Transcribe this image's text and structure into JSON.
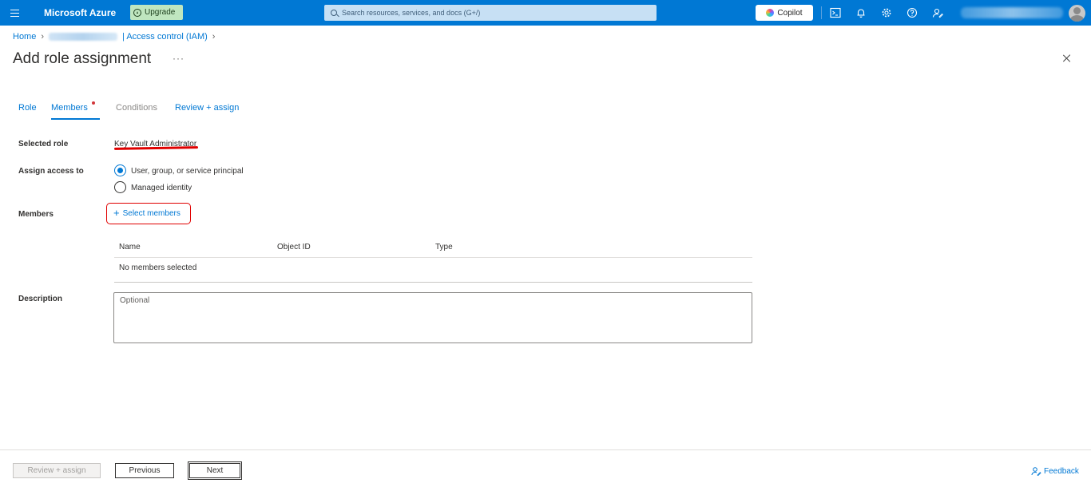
{
  "topbar": {
    "brand": "Microsoft Azure",
    "upgrade_label": "Upgrade",
    "search_placeholder": "Search resources, services, and docs (G+/)",
    "copilot_label": "Copilot",
    "icons": [
      "cloud-shell-icon",
      "bell-icon",
      "gear-icon",
      "help-icon",
      "feedback-person-icon"
    ]
  },
  "breadcrumb": {
    "home": "Home",
    "current": "| Access control (IAM)"
  },
  "page": {
    "title": "Add role assignment",
    "more": "···"
  },
  "tabs": [
    {
      "label": "Role",
      "state": "link"
    },
    {
      "label": "Members",
      "state": "active"
    },
    {
      "label": "Conditions",
      "state": "disabled"
    },
    {
      "label": "Review + assign",
      "state": "link"
    }
  ],
  "form": {
    "selected_role_label": "Selected role",
    "selected_role_value": "Key Vault Administrator",
    "assign_access_label": "Assign access to",
    "assign_options": [
      "User, group, or service principal",
      "Managed identity"
    ],
    "members_label": "Members",
    "select_members": "Select members",
    "table": {
      "columns": [
        "Name",
        "Object ID",
        "Type"
      ],
      "empty_message": "No members selected"
    },
    "description_label": "Description",
    "description_placeholder": "Optional"
  },
  "footer": {
    "review_assign": "Review + assign",
    "previous": "Previous",
    "next": "Next",
    "feedback": "Feedback"
  },
  "colors": {
    "azure_blue": "#0078d4",
    "annotation_red": "#e00000",
    "required_dot": "#d13438"
  }
}
